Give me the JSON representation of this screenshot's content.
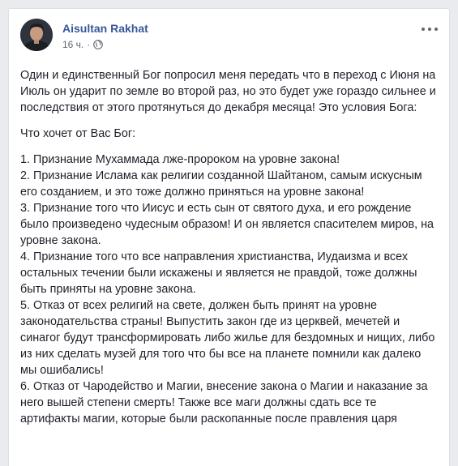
{
  "post": {
    "author": "Aisultan Rakhat",
    "time": "16 ч.",
    "separator": "·",
    "privacy_icon": "globe-icon",
    "more_icon": "more-options-icon",
    "intro": "Один и единственный Бог попросил меня передать что в переход с Июня на Июль он ударит по земле во второй раз, но это будет уже гораздо сильнее и последствия от этого протянуться до декабря месяца! Это условия Бога:",
    "question": "Что хочет от Вас Бог:",
    "items": [
      "1. Признание Мухаммада лже-пророком на уровне закона!",
      "2. Признание Ислама как религии созданной Шайтаном, самым искусным его созданием, и это тоже должно приняться на уровне закона!",
      "3. Признание того что Иисус и есть сын от святого духа, и его рождение было произведено чудесным образом! И он является спасителем миров, на уровне закона.",
      "4. Признание того что все направления христианства, Иудаизма и всех остальных течении были искажены и является не правдой, тоже должны быть приняты на уровне закона.",
      "5. Отказ от всех религий на свете, должен быть принят на уровне законодательства страны! Выпустить закон где из церквей, мечетей и синагог будут трансформировать либо жилье для бездомных и нищих, либо из них сделать музей для того что бы все на планете помнили как далеко мы ошибались!",
      "6. Отказ от Чародейство и Магии, внесение закона о Магии и наказание за него вышей степени смерть! Также все маги должны сдать все те артифакты магии, которые были раскопанные после правления царя"
    ]
  },
  "colors": {
    "page_bg": "#e9ebee",
    "card_bg": "#ffffff",
    "author_link": "#385898",
    "meta_text": "#616770",
    "body_text": "#1d2129"
  }
}
